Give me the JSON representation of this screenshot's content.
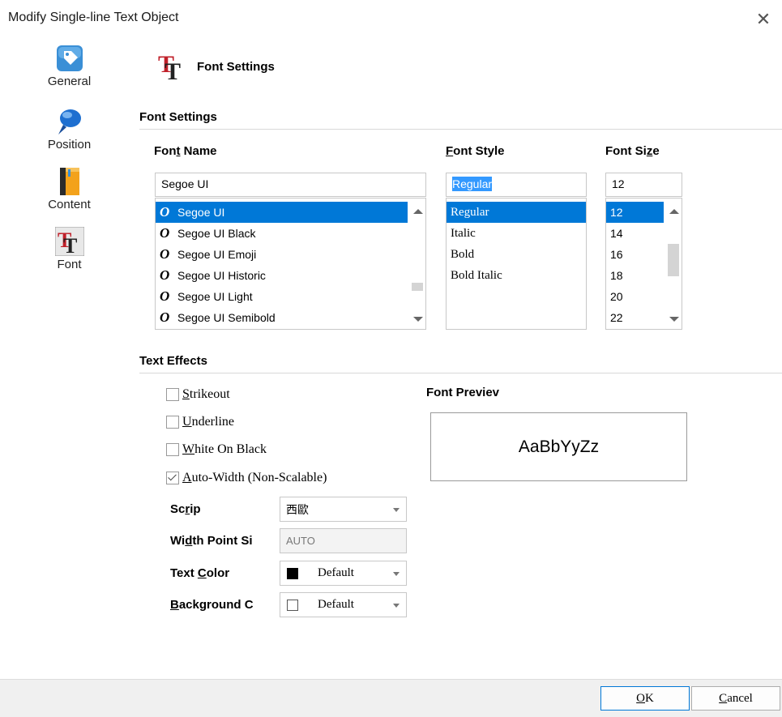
{
  "window": {
    "title": "Modify Single-line Text Object"
  },
  "sidebar": {
    "items": [
      {
        "label": "General",
        "icon": "tag-icon"
      },
      {
        "label": "Position",
        "icon": "pushpin-icon"
      },
      {
        "label": "Content",
        "icon": "book-icon"
      },
      {
        "label": "Font",
        "icon": "font-tt-icon"
      }
    ]
  },
  "page": {
    "header": "Font Settings"
  },
  "font_settings": {
    "section_title": "Font Settings",
    "font_name": {
      "label_pre": "Fon",
      "label_ul": "t",
      "label_post": " Name",
      "value": "Segoe UI",
      "options": [
        "Segoe UI",
        "Segoe UI Black",
        "Segoe UI Emoji",
        "Segoe UI Historic",
        "Segoe UI Light",
        "Segoe UI Semibold"
      ],
      "selected": "Segoe UI",
      "option_icon": "O"
    },
    "font_style": {
      "label_pre": "",
      "label_ul": "F",
      "label_post": "ont Style",
      "value": "Regular",
      "options": [
        "Regular",
        "Italic",
        "Bold",
        "Bold Italic"
      ],
      "selected": "Regular"
    },
    "font_size": {
      "label_pre": "Font Si",
      "label_ul": "z",
      "label_post": "e",
      "value": "12",
      "options": [
        "12",
        "14",
        "16",
        "18",
        "20",
        "22"
      ],
      "selected": "12"
    }
  },
  "text_effects": {
    "section_title": "Text Effects",
    "strikeout": {
      "ul": "S",
      "rest": "trikeout",
      "checked": false
    },
    "underline": {
      "ul": "U",
      "rest": "nderline",
      "checked": false
    },
    "white_on_black": {
      "ul": "W",
      "rest": "hite On Black",
      "checked": false
    },
    "auto_width": {
      "ul": "A",
      "rest": "uto-Width (Non-Scalable)",
      "checked": true
    },
    "script": {
      "label_pre": "Sc",
      "label_ul": "r",
      "label_post": "ip",
      "value": "西歐"
    },
    "width_point": {
      "label_pre": "Wi",
      "label_ul": "d",
      "label_post": "th Point Si",
      "value": "AUTO"
    },
    "text_color": {
      "label_pre": "Text ",
      "label_ul": "C",
      "label_post": "olor",
      "value": "Default",
      "swatch": "#000000"
    },
    "background_color": {
      "label_pre": "",
      "label_ul": "B",
      "label_post": "ackground C",
      "value": "Default",
      "swatch": "#ffffff"
    }
  },
  "preview": {
    "label": "Font Previev",
    "text": "AaBbYyZz"
  },
  "footer": {
    "ok_ul": "O",
    "ok_rest": "K",
    "cancel_ul": "C",
    "cancel_rest": "ancel"
  },
  "colors": {
    "selection": "#0078d7",
    "footer_bg": "#f0f0f0"
  }
}
